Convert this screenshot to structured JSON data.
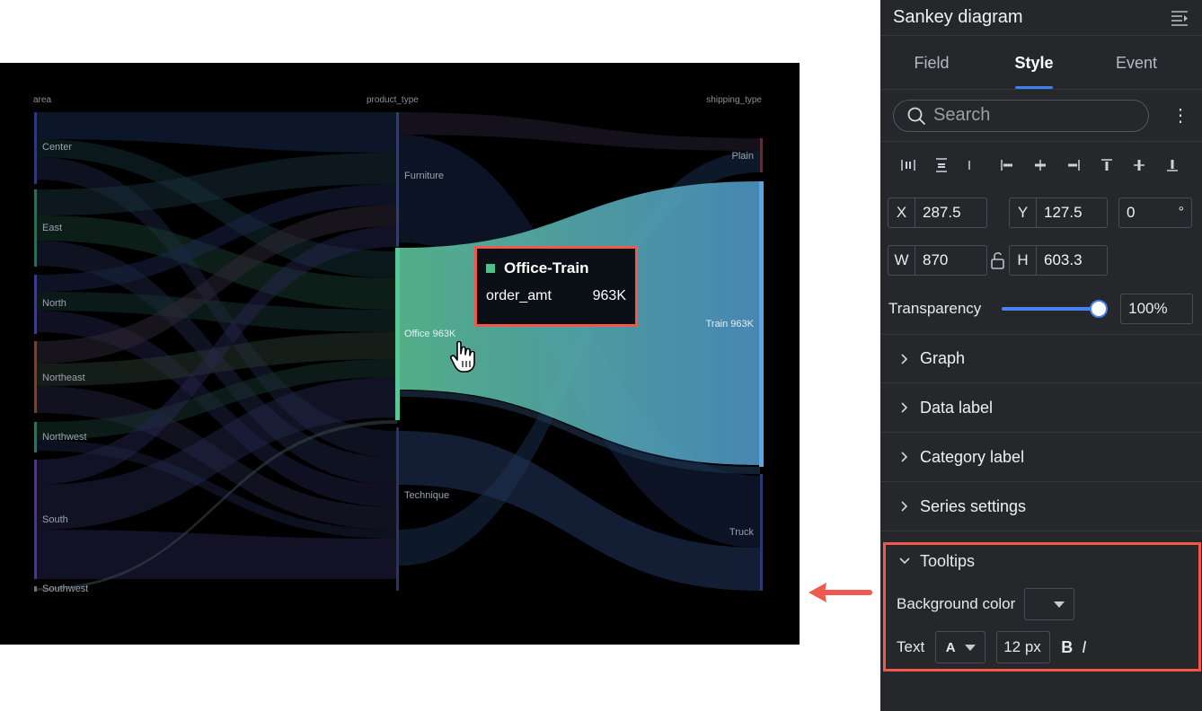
{
  "chart": {
    "columns": [
      "area",
      "product_type",
      "shipping_type"
    ],
    "nodes": {
      "area": [
        "Center",
        "East",
        "North",
        "Northeast",
        "Northwest",
        "South",
        "Southwest"
      ],
      "product_type": [
        "Furniture",
        "Office 963K",
        "Technique"
      ],
      "shipping_type": [
        "Plain",
        "Train 963K",
        "Truck"
      ]
    },
    "colors": {
      "background": "#000000",
      "highlight_link": "#5fb0d8",
      "office_node": "#4ec08a",
      "train_node": "#5aa7e8"
    }
  },
  "tooltip": {
    "title": "Office-Train",
    "metric": "order_amt",
    "value": "963K",
    "swatch_color": "#4ec08a"
  },
  "panel": {
    "title": "Sankey diagram",
    "tabs": [
      {
        "label": "Field",
        "active": false
      },
      {
        "label": "Style",
        "active": true
      },
      {
        "label": "Event",
        "active": false
      }
    ],
    "search_placeholder": "Search",
    "more_label": "⋮",
    "align_icons": [
      "distribute-horizontal-icon",
      "distribute-vertical-icon",
      "align-left-icon",
      "align-center-horizontal-icon",
      "align-right-icon",
      "align-top-icon",
      "align-middle-vertical-icon",
      "align-bottom-icon"
    ],
    "geometry": {
      "x_label": "X",
      "x_value": "287.5",
      "y_label": "Y",
      "y_value": "127.5",
      "rotation_value": "0",
      "rotation_unit": "°",
      "w_label": "W",
      "w_value": "870",
      "h_label": "H",
      "h_value": "603.3"
    },
    "transparency": {
      "label": "Transparency",
      "value_text": "100%",
      "level": 1.0
    },
    "sections": [
      "Graph",
      "Data label",
      "Category label",
      "Series settings"
    ],
    "tooltips_section": {
      "title": "Tooltips",
      "bg_label": "Background color",
      "text_label": "Text",
      "font_glyph": "A",
      "font_size": "12 px",
      "bold_label": "B",
      "italic_label": "I"
    },
    "accent_color": "#3d7ff0",
    "highlight_border": "#f0584c"
  }
}
